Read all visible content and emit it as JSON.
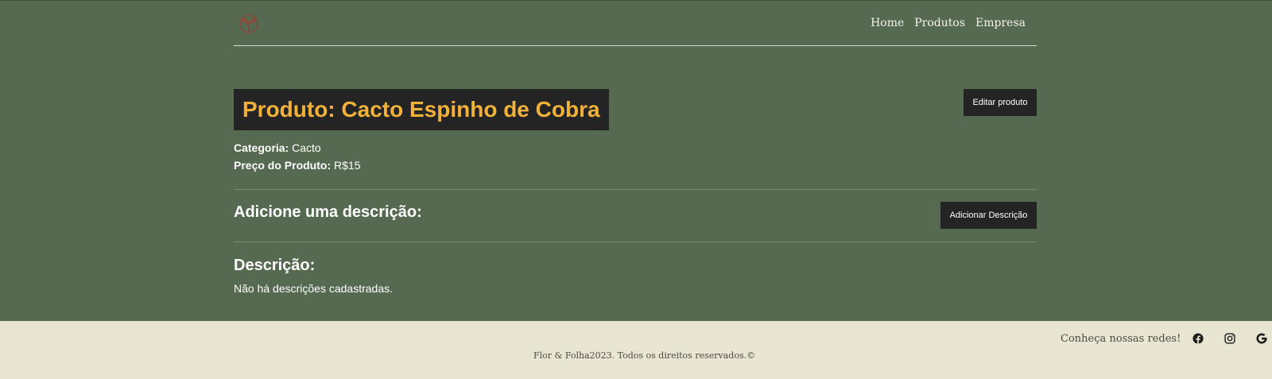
{
  "nav": {
    "logo_icon": "sprout-logo-icon",
    "links": [
      {
        "label": "Home"
      },
      {
        "label": "Produtos"
      },
      {
        "label": "Empresa"
      }
    ]
  },
  "product": {
    "title": "Produto: Cacto Espinho de Cobra",
    "category_label": "Categoria:",
    "category_value": "Cacto",
    "price_label": "Preço do Produto:",
    "price_value": "R$15"
  },
  "actions": {
    "edit_label": "Editar produto",
    "add_description_label": "Adicionar Descrição"
  },
  "add_description_heading": "Adicione uma descrição:",
  "description": {
    "heading": "Descrição:",
    "empty_text": "Não há descrições cadastradas."
  },
  "footer": {
    "copyright": "Flor & Folha2023. Todos os direitos reservados.©",
    "socials_label": "Conheça nossas redes!",
    "icons": [
      "facebook-icon",
      "instagram-icon",
      "google-icon"
    ]
  },
  "colors": {
    "background": "#566a51",
    "title_accent": "#f2b23a",
    "button_bg": "#242424",
    "footer_bg": "#e8e6d3"
  }
}
